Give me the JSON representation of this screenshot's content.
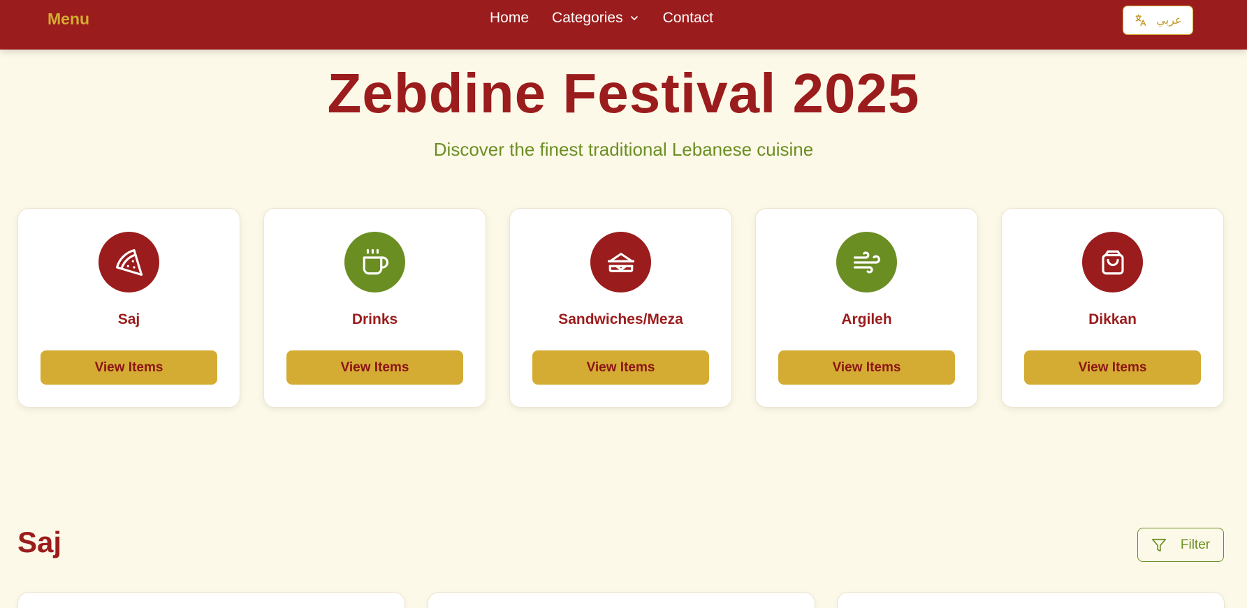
{
  "nav": {
    "brand": "Menu",
    "links": [
      {
        "label": "Home"
      },
      {
        "label": "Categories",
        "icon": "chevron-down-icon"
      },
      {
        "label": "Contact"
      }
    ],
    "language_button": {
      "label": "عربي",
      "icon": "translate-icon"
    }
  },
  "hero": {
    "title": "Zebdine Festival 2025",
    "subtitle": "Discover the finest traditional Lebanese cuisine"
  },
  "categories": [
    {
      "name": "Saj",
      "icon": "pizza-slice-icon",
      "color": "#9b1c1c",
      "button_label": "View Items"
    },
    {
      "name": "Drinks",
      "icon": "coffee-cup-icon",
      "color": "#6b8e23",
      "button_label": "View Items"
    },
    {
      "name": "Sandwiches/Meza",
      "icon": "sandwich-icon",
      "color": "#9b1c1c",
      "button_label": "View Items"
    },
    {
      "name": "Argileh",
      "icon": "wind-icon",
      "color": "#6b8e23",
      "button_label": "View Items"
    },
    {
      "name": "Dikkan",
      "icon": "shopping-bag-icon",
      "color": "#9b1c1c",
      "button_label": "View Items"
    }
  ],
  "section": {
    "title": "Saj",
    "filter_label": "Filter",
    "filter_icon": "filter-icon"
  },
  "colors": {
    "primary": "#9b1c1c",
    "accent": "#d4ac34",
    "secondary": "#6b8e23",
    "background": "#fdf9e8"
  }
}
